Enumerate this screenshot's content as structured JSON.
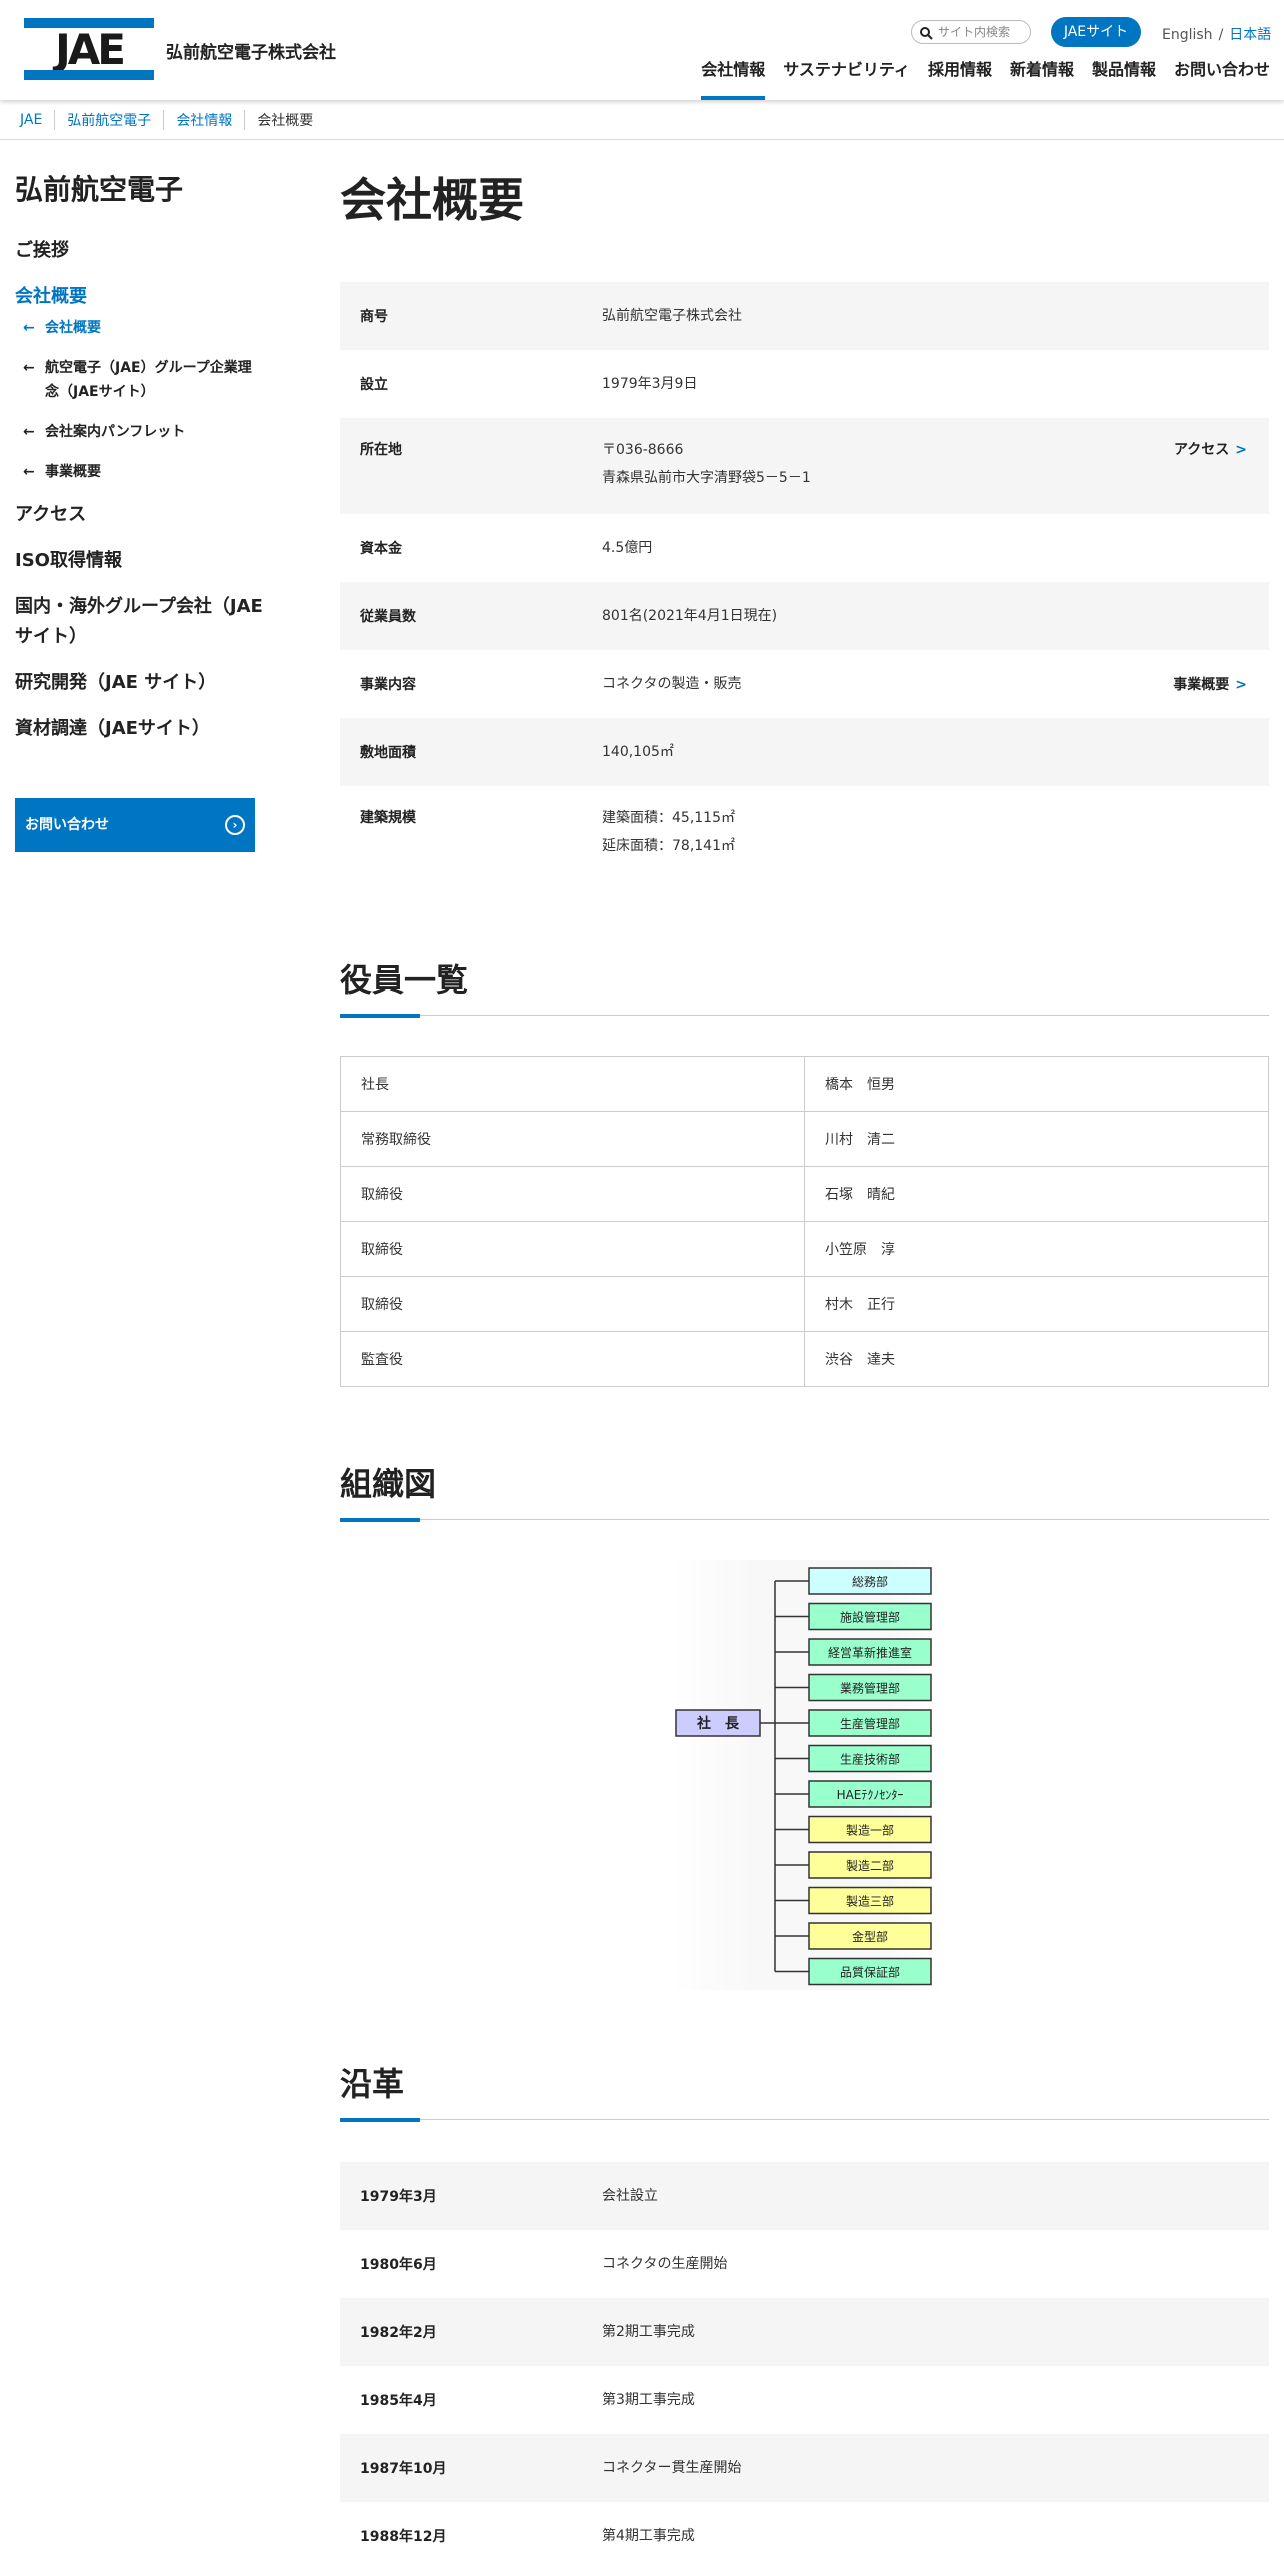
{
  "header": {
    "company_name": "弘前航空電子株式会社",
    "logo_text": "JAE",
    "search_placeholder": "サイト内検索",
    "jae_site": "JAEサイト",
    "lang_en": "English",
    "lang_sep": "/",
    "lang_ja": "日本語",
    "nav": [
      "会社情報",
      "サステナビリティ",
      "採用情報",
      "新着情報",
      "製品情報",
      "お問い合わせ"
    ],
    "accent_color": "#0075c1"
  },
  "breadcrumb": [
    "JAE",
    "弘前航空電子",
    "会社情報",
    "会社概要"
  ],
  "sidebar": {
    "title": "弘前航空電子",
    "greeting": "ご挨拶",
    "overview": "会社概要",
    "sub": [
      "会社概要",
      "航空電子（JAE）グループ企業理念（JAEサイト）",
      "会社案内パンフレット",
      "事業概要"
    ],
    "items": [
      "アクセス",
      "ISO取得情報",
      "国内・海外グループ会社（JAEサイト）",
      "研究開発（JAE サイト）",
      "資材調達（JAEサイト）"
    ],
    "contact": "お問い合わせ"
  },
  "main": {
    "title": "会社概要",
    "profile": [
      {
        "label": "商号",
        "value": "弘前航空電子株式会社"
      },
      {
        "label": "設立",
        "value": "1979年3月9日"
      },
      {
        "label": "所在地",
        "value": "〒036-8666",
        "value2": "青森県弘前市大字清野袋5－5－1",
        "link": "アクセス"
      },
      {
        "label": "資本金",
        "value": "4.5億円"
      },
      {
        "label": "従業員数",
        "value": "801名(2021年4月1日現在)"
      },
      {
        "label": "事業内容",
        "value": "コネクタの製造・販売",
        "link": "事業概要"
      },
      {
        "label": "敷地面積",
        "value": "140,105㎡"
      },
      {
        "label": "建築規模",
        "value": "建築面積：45,115㎡",
        "value2": "延床面積：78,141㎡"
      }
    ],
    "officers_title": "役員一覧",
    "officers": [
      {
        "role": "社長",
        "name": "橋本　恒男"
      },
      {
        "role": "常務取締役",
        "name": "川村　清二"
      },
      {
        "role": "取締役",
        "name": "石塚　晴紀"
      },
      {
        "role": "取締役",
        "name": "小笠原　淳"
      },
      {
        "role": "取締役",
        "name": "村木　正行"
      },
      {
        "role": "監査役",
        "name": "渋谷　達夫"
      }
    ],
    "org_title": "組織図",
    "org": {
      "root": "社　長",
      "departments": [
        {
          "name": "総務部",
          "color": "#ccffff"
        },
        {
          "name": "施設管理部",
          "color": "#99ffcc"
        },
        {
          "name": "経営革新推進室",
          "color": "#99ffcc"
        },
        {
          "name": "業務管理部",
          "color": "#99ffcc"
        },
        {
          "name": "生産管理部",
          "color": "#99ffcc"
        },
        {
          "name": "生産技術部",
          "color": "#99ffcc"
        },
        {
          "name": "HAEﾃｸﾉｾﾝﾀｰ",
          "color": "#99ffcc"
        },
        {
          "name": "製造一部",
          "color": "#ffff99"
        },
        {
          "name": "製造二部",
          "color": "#ffff99"
        },
        {
          "name": "製造三部",
          "color": "#ffff99"
        },
        {
          "name": "金型部",
          "color": "#ffff99"
        },
        {
          "name": "品質保証部",
          "color": "#99ffcc"
        }
      ],
      "root_color": "#ccccff"
    },
    "history_title": "沿革",
    "history": [
      {
        "date": "1979年3月",
        "event": "会社設立"
      },
      {
        "date": "1980年6月",
        "event": "コネクタの生産開始"
      },
      {
        "date": "1982年2月",
        "event": "第2期工事完成"
      },
      {
        "date": "1985年4月",
        "event": "第3期工事完成"
      },
      {
        "date": "1987年10月",
        "event": "コネクター貫生産開始"
      },
      {
        "date": "1988年12月",
        "event": "第4期工事完成"
      }
    ]
  }
}
